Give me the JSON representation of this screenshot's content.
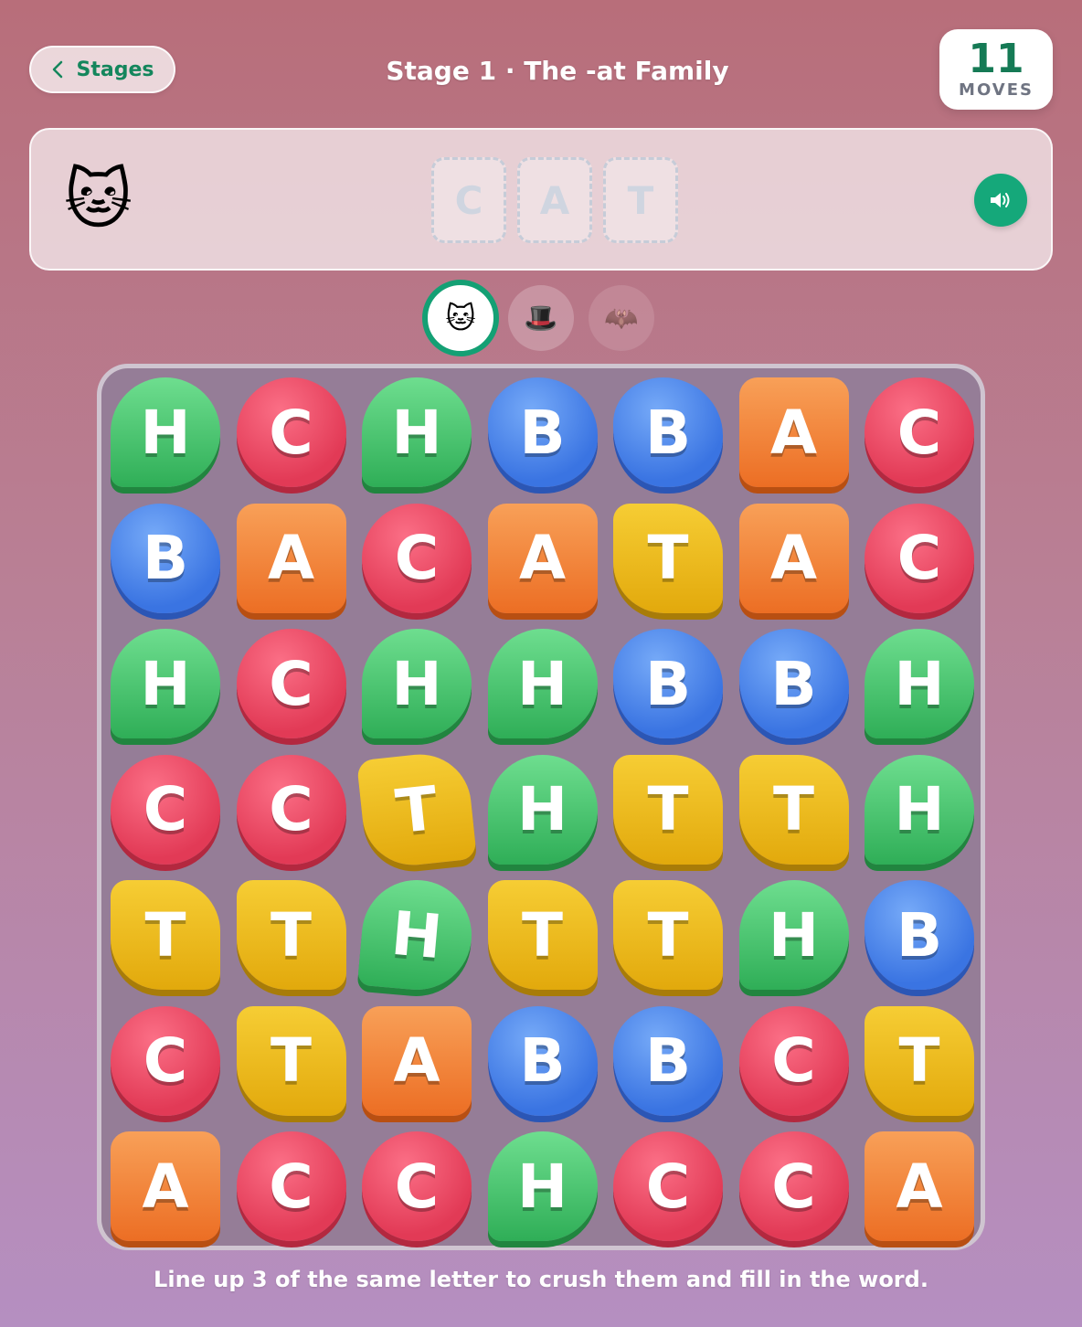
{
  "header": {
    "back_label": "Stages",
    "title": "Stage 1 · The -at Family",
    "moves_value": "11",
    "moves_label": "MOVES"
  },
  "target": {
    "emoji": "🐱",
    "slots": [
      "C",
      "A",
      "T"
    ]
  },
  "word_picker": [
    "🐱",
    "🎩",
    "🦇"
  ],
  "board": {
    "rows": [
      [
        "H",
        "C",
        "H",
        "B",
        "B",
        "A",
        "C"
      ],
      [
        "B",
        "A",
        "C",
        "A",
        "T",
        "A",
        "C"
      ],
      [
        "H",
        "C",
        "H",
        "H",
        "B",
        "B",
        "H"
      ],
      [
        "C",
        "C",
        "T",
        "H",
        "T",
        "T",
        "H"
      ],
      [
        "T",
        "T",
        "H",
        "T",
        "T",
        "H",
        "B"
      ],
      [
        "C",
        "T",
        "A",
        "B",
        "B",
        "C",
        "T"
      ],
      [
        "A",
        "C",
        "C",
        "H",
        "C",
        "C",
        "A"
      ]
    ]
  },
  "hint": "Line up 3 of the same letter to crush them and fill in the word.",
  "colors": {
    "accent": "#15a87a",
    "C": "#e23a56",
    "H": "#2fae57",
    "B": "#3a74e2",
    "A": "#ec6e24",
    "T": "#e2a90c"
  }
}
